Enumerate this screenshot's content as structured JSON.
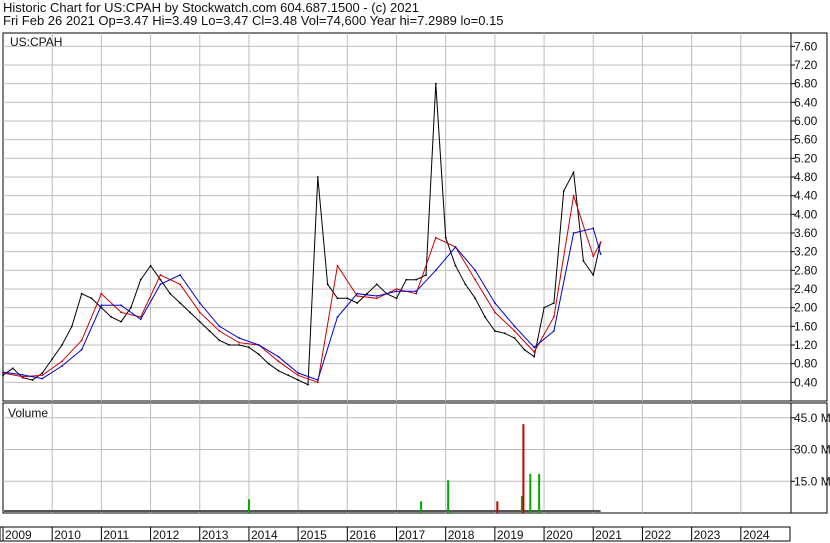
{
  "header": {
    "title_line": "Historic Chart for US:CPAH by Stockwatch.com 604.687.1500 - (c) 2021",
    "quote_line": "Fri Feb 26 2021  Op=3.47  Hi=3.49  Lo=3.47  Cl=3.48  Vol=74,600  Year hi=7.2989  lo=0.15"
  },
  "colors": {
    "price": "#000000",
    "ma_short": "#cc0000",
    "ma_mid": "#cc00cc",
    "ma_long": "#0000cc",
    "grid": "#bdbdbd",
    "volume_up": "#00aa00",
    "volume_down": "#cc0000"
  },
  "chart_data": [
    {
      "type": "line",
      "panel": "price",
      "symbol_label": "US:CPAH",
      "ylim": [
        0,
        7.8
      ],
      "yticks": [
        "0.40",
        "0.80",
        "1.20",
        "1.60",
        "2.00",
        "2.40",
        "2.80",
        "3.20",
        "3.60",
        "4.00",
        "4.40",
        "4.80",
        "5.20",
        "5.60",
        "6.00",
        "6.40",
        "6.80",
        "7.20",
        "7.60"
      ],
      "x_categories": [
        "2009",
        "2010",
        "2011",
        "2012",
        "2013",
        "2014",
        "2015",
        "2016",
        "2017",
        "2018",
        "2019",
        "2020",
        "2021",
        "2022",
        "2023",
        "2024"
      ],
      "grid": true,
      "series": [
        {
          "name": "",
          "x": [
            2009.0,
            2009.2,
            2009.4,
            2009.6,
            2009.8,
            2010.0,
            2010.2,
            2010.4,
            2010.6,
            2010.8,
            2011.0,
            2011.2,
            2011.4,
            2011.6,
            2011.8,
            2012.0,
            2012.2,
            2012.4,
            2012.6,
            2012.8,
            2013.0,
            2013.2,
            2013.4,
            2013.6,
            2013.8,
            2014.0,
            2014.2,
            2014.4,
            2014.6,
            2014.8,
            2015.0,
            2015.2,
            2015.4,
            2015.6,
            2015.8,
            2016.0,
            2016.2,
            2016.4,
            2016.6,
            2016.8,
            2017.0,
            2017.2,
            2017.4,
            2017.6,
            2017.8,
            2018.0,
            2018.2,
            2018.4,
            2018.6,
            2018.8,
            2019.0,
            2019.2,
            2019.4,
            2019.6,
            2019.8,
            2020.0,
            2020.2,
            2020.4,
            2020.6,
            2020.8,
            2021.0,
            2021.15
          ],
          "values": [
            0.55,
            0.7,
            0.5,
            0.45,
            0.6,
            0.9,
            1.2,
            1.6,
            2.3,
            2.2,
            2.0,
            1.8,
            1.7,
            2.0,
            2.6,
            2.9,
            2.6,
            2.3,
            2.1,
            1.9,
            1.7,
            1.5,
            1.3,
            1.2,
            1.2,
            1.15,
            1.0,
            0.8,
            0.65,
            0.55,
            0.45,
            0.35,
            4.8,
            2.5,
            2.2,
            2.2,
            2.1,
            2.3,
            2.5,
            2.3,
            2.2,
            2.6,
            2.6,
            2.7,
            6.8,
            3.5,
            2.9,
            2.5,
            2.2,
            1.8,
            1.5,
            1.45,
            1.35,
            1.1,
            0.95,
            2.0,
            2.1,
            4.5,
            4.9,
            3.0,
            2.7,
            3.4
          ]
        },
        {
          "name": "",
          "x": [
            2009.0,
            2009.4,
            2009.8,
            2010.2,
            2010.6,
            2011.0,
            2011.4,
            2011.8,
            2012.2,
            2012.6,
            2013.0,
            2013.4,
            2013.8,
            2014.2,
            2014.6,
            2015.0,
            2015.4,
            2015.8,
            2016.2,
            2016.6,
            2017.0,
            2017.4,
            2017.8,
            2018.2,
            2018.6,
            2019.0,
            2019.4,
            2019.8,
            2020.2,
            2020.6,
            2021.0,
            2021.15
          ],
          "values": [
            0.6,
            0.52,
            0.55,
            0.85,
            1.3,
            2.3,
            1.9,
            1.8,
            2.7,
            2.5,
            1.9,
            1.5,
            1.25,
            1.2,
            0.85,
            0.55,
            0.4,
            2.9,
            2.25,
            2.2,
            2.4,
            2.3,
            3.5,
            3.3,
            2.6,
            1.9,
            1.5,
            1.05,
            1.8,
            4.4,
            3.1,
            3.4
          ]
        },
        {
          "name": "",
          "x": [
            2009.0,
            2009.4,
            2009.8,
            2010.2,
            2010.6,
            2011.0,
            2011.4,
            2011.8,
            2012.2,
            2012.6,
            2013.0,
            2013.4,
            2013.8,
            2014.2,
            2014.6,
            2015.0,
            2015.4,
            2015.8,
            2016.2,
            2016.6,
            2017.0,
            2017.4,
            2017.8,
            2018.2,
            2018.6,
            2019.0,
            2019.4,
            2019.8,
            2020.2,
            2020.6,
            2021.0,
            2021.15
          ],
          "values": [
            0.62,
            0.56,
            0.48,
            0.75,
            1.1,
            2.05,
            2.05,
            1.75,
            2.5,
            2.7,
            2.1,
            1.6,
            1.35,
            1.2,
            0.95,
            0.6,
            0.45,
            1.8,
            2.3,
            2.25,
            2.35,
            2.35,
            2.8,
            3.3,
            2.8,
            2.1,
            1.6,
            1.15,
            1.5,
            3.6,
            3.7,
            3.15
          ]
        }
      ]
    },
    {
      "type": "bar",
      "panel": "volume",
      "ylabel": "Volume",
      "ylim": [
        0,
        52
      ],
      "yticks": [
        "15.0",
        "30.0",
        "45.0"
      ],
      "tick_suffix": "M",
      "series": [
        {
          "name": "",
          "x": [
            2014.0,
            2017.5,
            2018.05,
            2019.05,
            2019.55,
            2019.58,
            2019.72,
            2019.9
          ],
          "values": [
            6.5,
            5.5,
            15.5,
            5.5,
            8.0,
            42.0,
            18.5,
            18.5
          ]
        }
      ]
    }
  ]
}
